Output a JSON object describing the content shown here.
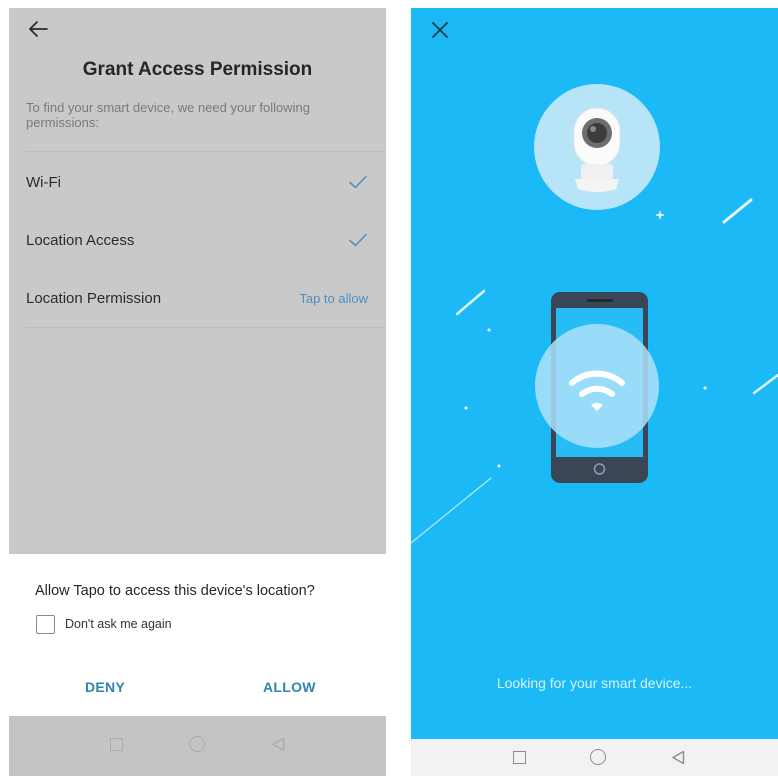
{
  "left": {
    "header": {
      "title": "Grant Access Permission"
    },
    "description": "To find your smart device, we need your following permissions:",
    "permissions": [
      {
        "label": "Wi-Fi",
        "status": "granted"
      },
      {
        "label": "Location Access",
        "status": "granted"
      },
      {
        "label": "Location Permission",
        "status": "pending",
        "action": "Tap to allow"
      }
    ],
    "dialog": {
      "title": "Allow Tapo to access this device's location?",
      "checkbox_label": "Don't ask me again",
      "checkbox_checked": false,
      "deny_label": "DENY",
      "allow_label": "ALLOW"
    }
  },
  "right": {
    "status_text": "Looking for your smart device..."
  },
  "icons": {
    "back": "arrow-left-icon",
    "check": "checkmark-icon",
    "close": "close-icon",
    "camera": "camera-icon",
    "phone": "phone-icon",
    "wifi": "wifi-icon",
    "nav_recent": "square-icon",
    "nav_home": "circle-icon",
    "nav_back": "triangle-back-icon"
  },
  "colors": {
    "accent": "#4f8fc2",
    "dialog_button": "#2f86a8",
    "right_background": "#1bb9f5"
  }
}
